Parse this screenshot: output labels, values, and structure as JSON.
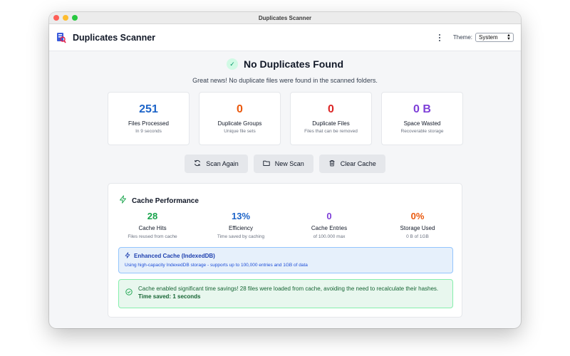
{
  "window": {
    "title": "Duplicates Scanner"
  },
  "app": {
    "name": "Duplicates Scanner",
    "theme_label": "Theme:",
    "theme_value": "System"
  },
  "status": {
    "title": "No Duplicates Found",
    "subtitle": "Great news! No duplicate files were found in the scanned folders."
  },
  "stats": [
    {
      "value": "251",
      "label": "Files Processed",
      "sub": "In 9 seconds",
      "color": "#1d64c8"
    },
    {
      "value": "0",
      "label": "Duplicate Groups",
      "sub": "Unique file sets",
      "color": "#ea580c"
    },
    {
      "value": "0",
      "label": "Duplicate Files",
      "sub": "Files that can be removed",
      "color": "#dc2626"
    },
    {
      "value": "0 B",
      "label": "Space Wasted",
      "sub": "Recoverable storage",
      "color": "#7e3fd8"
    }
  ],
  "buttons": {
    "scan_again": "Scan Again",
    "new_scan": "New Scan",
    "clear_cache": "Clear Cache"
  },
  "cache": {
    "title": "Cache Performance",
    "stats": [
      {
        "value": "28",
        "label": "Cache Hits",
        "sub": "Files reused from cache",
        "color": "#16a34a"
      },
      {
        "value": "13%",
        "label": "Efficiency",
        "sub": "Time saved by caching",
        "color": "#1d64c8"
      },
      {
        "value": "0",
        "label": "Cache Entries",
        "sub": "of 100.000 max",
        "color": "#7e3fd8"
      },
      {
        "value": "0%",
        "label": "Storage Used",
        "sub": "0 B of 1GB",
        "color": "#ea580c"
      }
    ],
    "info_title": "Enhanced Cache (IndexedDB)",
    "info_text": "Using high-capacity IndexedDB storage - supports up to 100,000 entries and 1GB of data",
    "success_text": "Cache enabled significant time savings! 28 files were loaded from cache, avoiding the need to recalculate their hashes.",
    "success_time": "Time saved: 1 seconds"
  }
}
